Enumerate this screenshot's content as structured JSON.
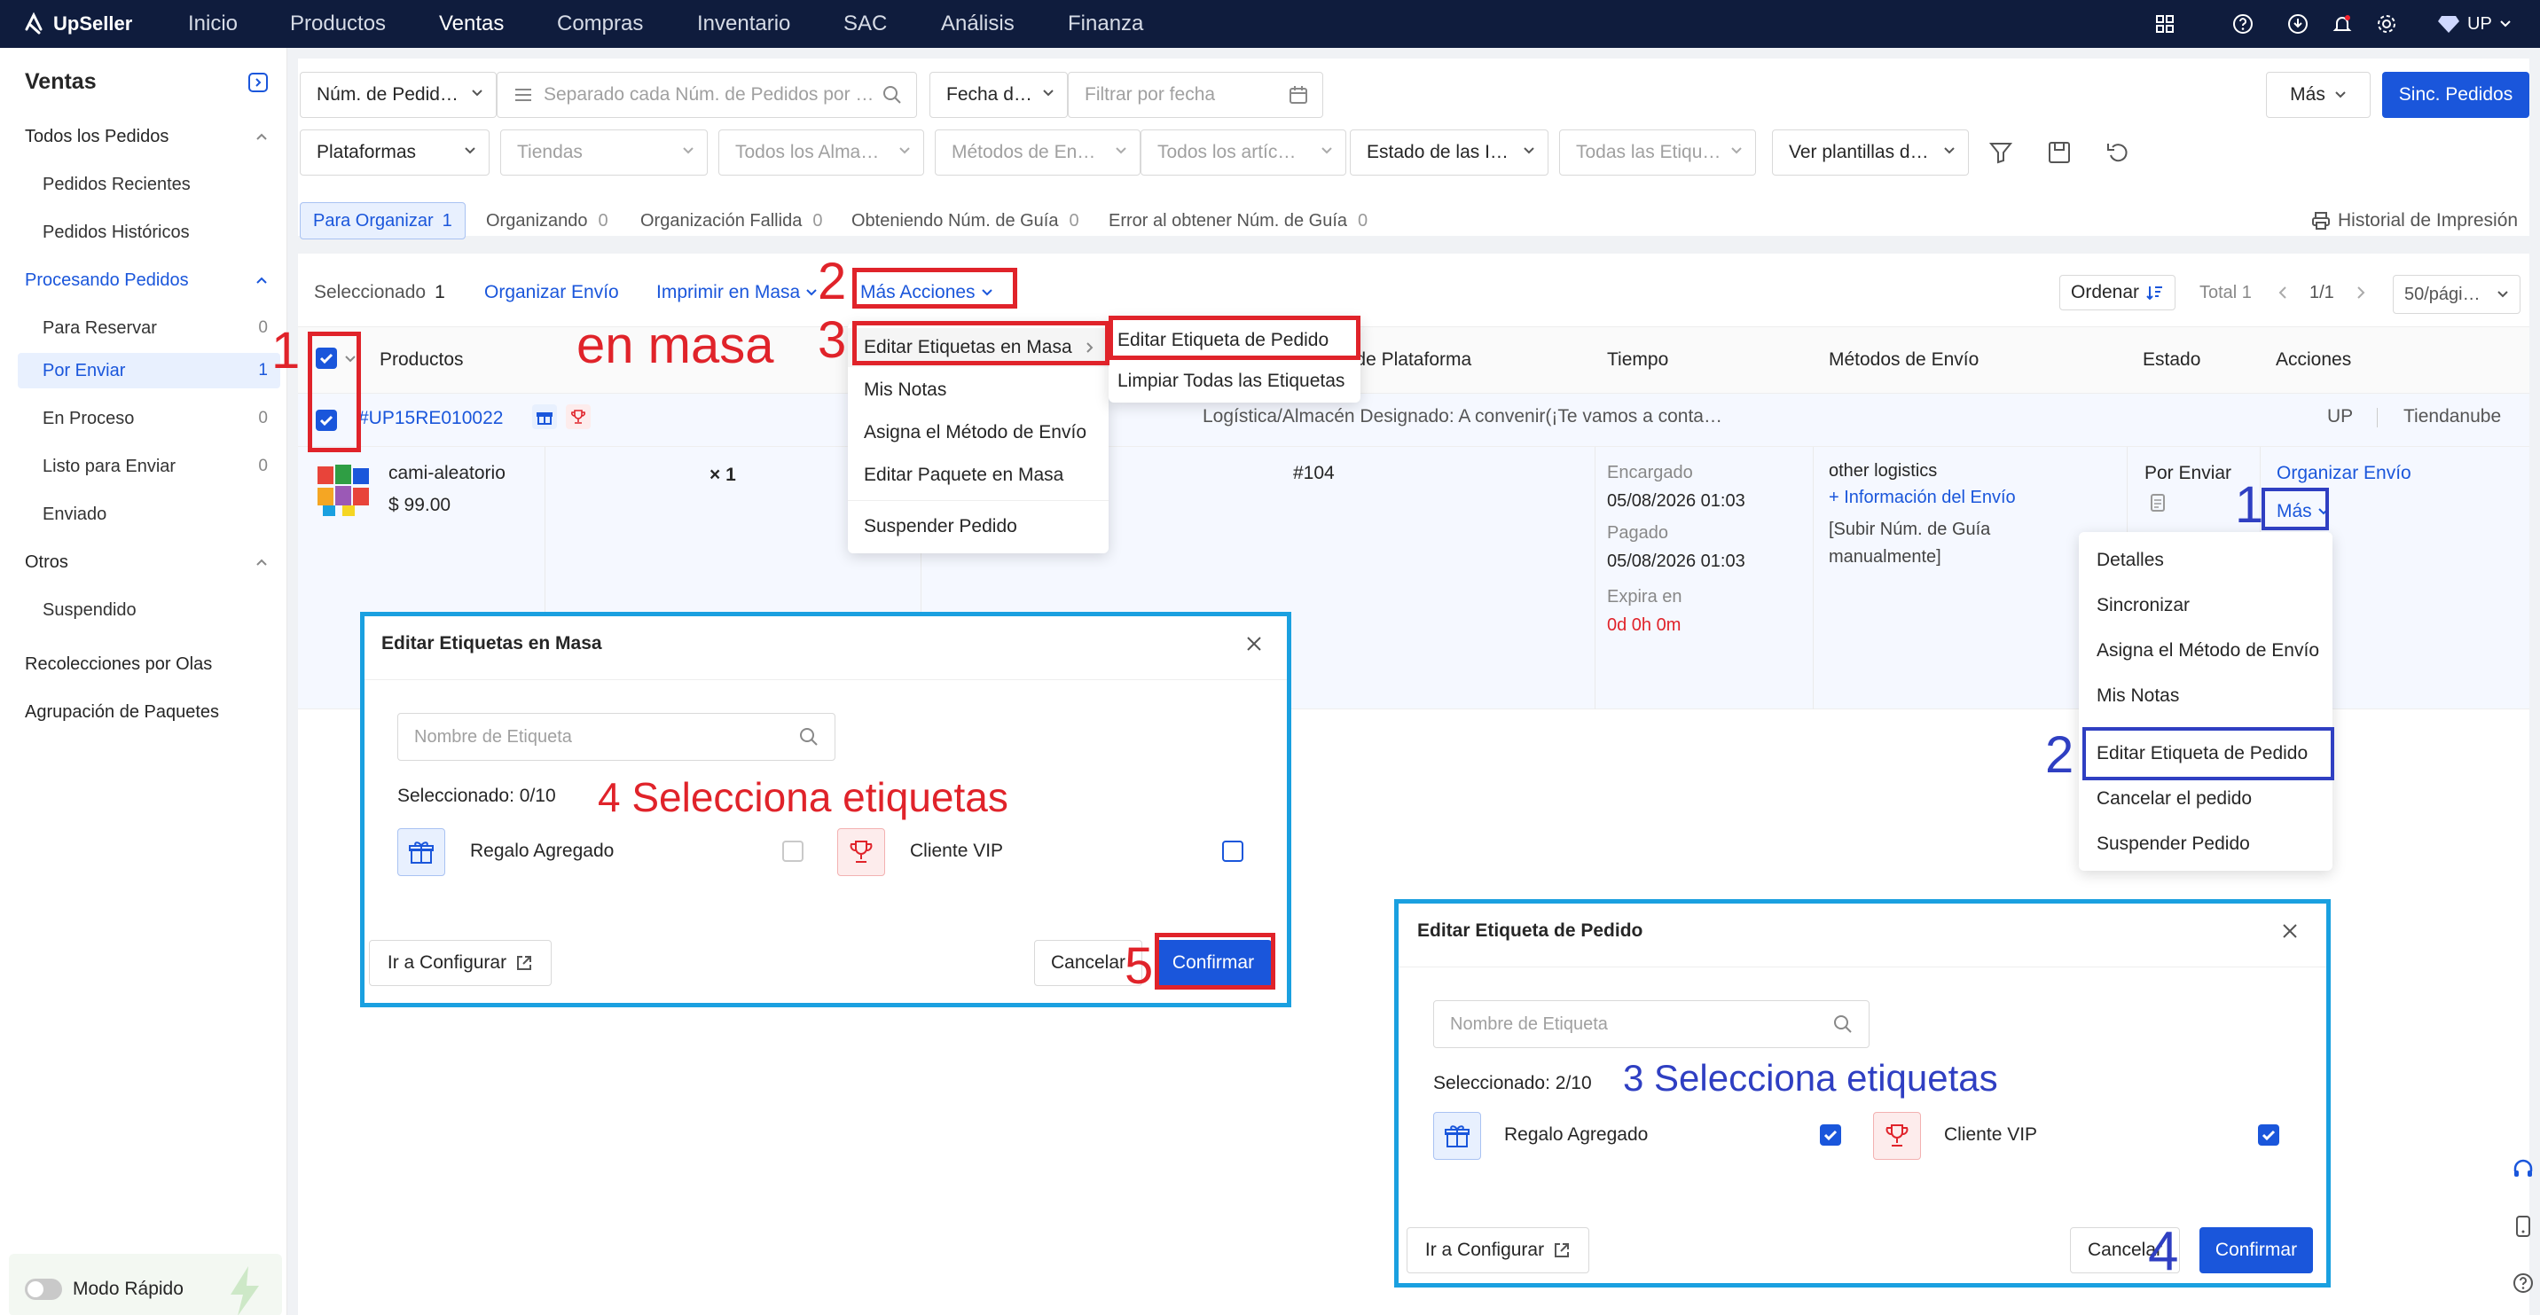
{
  "app": {
    "brand": "UpSeller",
    "user": "UP"
  },
  "nav": [
    "Inicio",
    "Productos",
    "Ventas",
    "Compras",
    "Inventario",
    "SAC",
    "Análisis",
    "Finanza"
  ],
  "sidebar": {
    "title": "Ventas",
    "groups": [
      {
        "label": "Todos los Pedidos",
        "items": [
          {
            "label": "Pedidos Recientes"
          },
          {
            "label": "Pedidos Históricos"
          }
        ]
      },
      {
        "label": "Procesando Pedidos",
        "items": [
          {
            "label": "Para Reservar",
            "count": "0"
          },
          {
            "label": "Por Enviar",
            "count": "1"
          },
          {
            "label": "En Proceso",
            "count": "0"
          },
          {
            "label": "Listo para Enviar",
            "count": "0"
          },
          {
            "label": "Enviado"
          }
        ]
      },
      {
        "label": "Otros",
        "items": [
          {
            "label": "Suspendido"
          }
        ]
      }
    ],
    "extra": [
      "Recolecciones por Olas",
      "Agrupación de Paquetes"
    ],
    "quick_mode": "Modo Rápido"
  },
  "filters": {
    "order_select": "Núm. de Pedid…",
    "search_placeholder": "Separado cada Núm. de Pedidos por …",
    "date_select": "Fecha d…",
    "date_placeholder": "Filtrar por fecha",
    "more": "Más",
    "sync": "Sinc. Pedidos",
    "row2": [
      "Plataformas",
      "Tiendas",
      "Todos los Alma…",
      "Métodos de En…",
      "Todos los artíc…",
      "Estado de las I…",
      "Todas las Etiqu…",
      "Ver plantillas d…"
    ]
  },
  "tabs": [
    {
      "label": "Para Organizar",
      "count": "1"
    },
    {
      "label": "Organizando",
      "count": "0"
    },
    {
      "label": "Organización Fallida",
      "count": "0"
    },
    {
      "label": "Obteniendo Núm. de Guía",
      "count": "0"
    },
    {
      "label": "Error al obtener Núm. de Guía",
      "count": "0"
    }
  ],
  "print_history": "Historial de Impresión",
  "toolbar": {
    "selected_label": "Seleccionado",
    "selected_count": "1",
    "organize": "Organizar Envío",
    "print": "Imprimir en Masa",
    "more_actions": "Más Acciones",
    "sort": "Ordenar",
    "total": "Total 1",
    "page": "1/1",
    "per_page": "50/pági…"
  },
  "columns": [
    "Productos",
    "Núm. de Pedido de Plataforma",
    "Tiempo",
    "Métodos de Envío",
    "Estado",
    "Acciones"
  ],
  "order": {
    "id": "#UP15RE010022",
    "logistics": "Logística/Almacén Designado:  A convenir(¡Te vamos a conta…",
    "shop": "UP",
    "platform": "Tiendanube",
    "product": "cami-aleatorio",
    "price": "$ 99.00",
    "qty": "× 1",
    "platform_no": "#104",
    "time": {
      "ordered_label": "Encargado",
      "ordered": "05/08/2026 01:03",
      "paid_label": "Pagado",
      "paid": "05/08/2026 01:03",
      "expires_label": "Expira en",
      "expires": "0d 0h 0m"
    },
    "shipping": {
      "method": "other logistics",
      "info": "+ Información del Envío",
      "note": "[Subir Núm. de Guía manualmente]"
    },
    "status": "Por Enviar",
    "action": "Organizar Envío",
    "more": "Más"
  },
  "more_actions_menu": [
    "Editar Etiquetas en Masa",
    "Mis Notas",
    "Asigna el Método de Envío",
    "Editar Paquete en Masa",
    "Suspender Pedido"
  ],
  "submenu": [
    "Editar Etiqueta de Pedido",
    "Limpiar Todas las Etiquetas"
  ],
  "row_more_menu": [
    "Detalles",
    "Sincronizar",
    "Asigna el Método de Envío",
    "Mis Notas",
    "Editar Etiqueta de Pedido",
    "Cancelar el pedido",
    "Suspender Pedido"
  ],
  "modal_bulk": {
    "title": "Editar Etiquetas en Masa",
    "search_placeholder": "Nombre de Etiqueta",
    "selected": "Seleccionado:  0/10",
    "tags": [
      "Regalo Agregado",
      "Cliente VIP"
    ],
    "configure": "Ir a Configurar",
    "cancel": "Cancelar",
    "confirm": "Confirmar"
  },
  "modal_single": {
    "title": "Editar Etiqueta de Pedido",
    "search_placeholder": "Nombre de Etiqueta",
    "selected": "Seleccionado:  2/10",
    "tags": [
      "Regalo Agregado",
      "Cliente VIP"
    ],
    "configure": "Ir a Configurar",
    "cancel": "Cancelar",
    "confirm": "Confirmar"
  },
  "annotations": {
    "red": {
      "n1": "1",
      "n2": "2",
      "n3": "3",
      "n4": "4 Selecciona etiquetas",
      "n5": "5",
      "bulk": "en masa"
    },
    "blue": {
      "n1": "1",
      "n2": "2",
      "n3": "3 Selecciona etiquetas",
      "n4": "4"
    }
  },
  "colors": {
    "primary": "#1a56db",
    "topbar": "#0f1c3d",
    "annotation_red": "#e0232a",
    "annotation_blue": "#2f3fc2",
    "frame_cyan": "#1aa0e0",
    "expire": "#e0232a"
  }
}
